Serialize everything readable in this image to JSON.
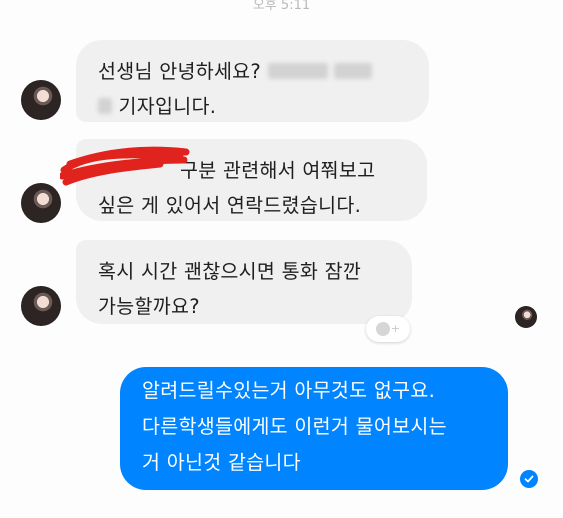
{
  "chat": {
    "timestamp": "오후 5:11",
    "messages": [
      {
        "direction": "incoming",
        "line1_prefix": "선생님 안녕하세요?",
        "line2_suffix": "기자입니다."
      },
      {
        "direction": "incoming",
        "line1_suffix": "구분 관련해서 여쭤보고",
        "line2": "싶은 게 있어서 연락드렸습니다."
      },
      {
        "direction": "incoming",
        "line1": "혹시 시간 괜찮으시면 통화 잠깐",
        "line2": "가능할까요?"
      },
      {
        "direction": "outgoing",
        "line1": "알려드릴수있는거 아무것도 없구요.",
        "line2": "다른학생들에게도 이런거 물어보시는",
        "line3": "거 아닌것 같습니다"
      }
    ]
  },
  "icons": {
    "avatar": "contact-avatar-photo",
    "reaction": "add-reaction-icon",
    "delivered": "check-circle-icon",
    "redaction": "red-scribble-redaction"
  },
  "colors": {
    "incoming_bubble": "#f1f0f0",
    "outgoing_bubble": "#0084ff",
    "redaction": "#e0231c"
  }
}
